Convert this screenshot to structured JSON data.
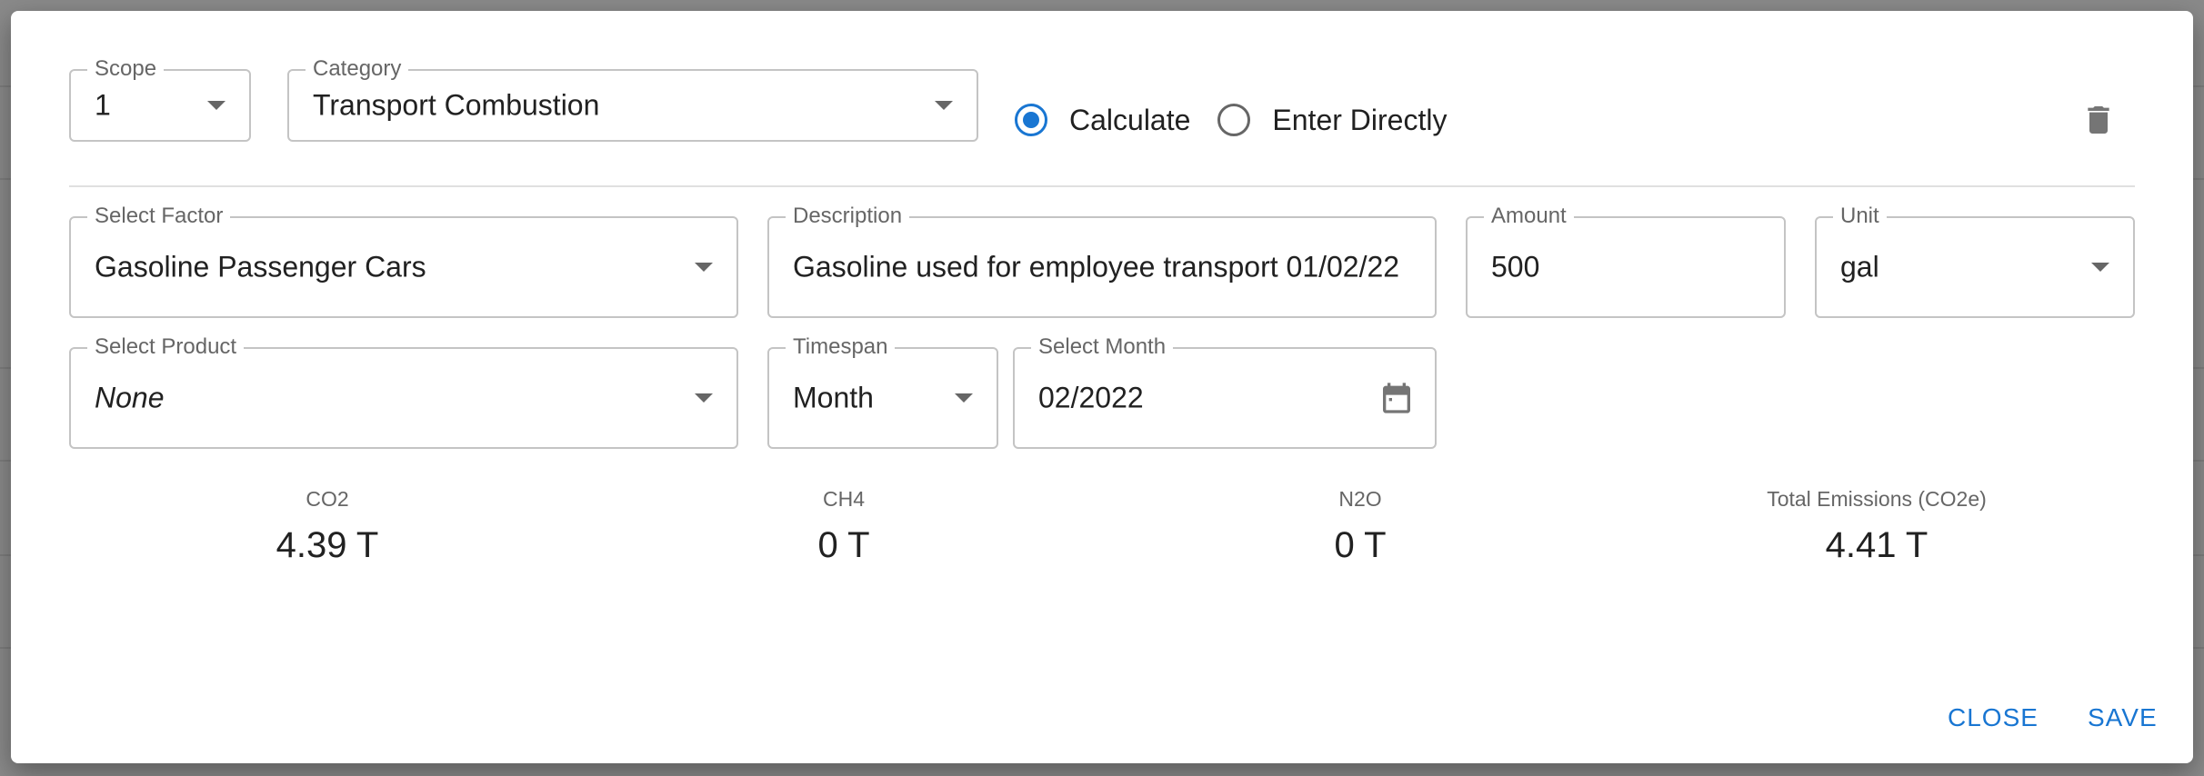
{
  "header": {
    "scope": {
      "label": "Scope",
      "value": "1"
    },
    "category": {
      "label": "Category",
      "value": "Transport Combustion"
    },
    "mode": {
      "options": [
        {
          "label": "Calculate",
          "selected": true
        },
        {
          "label": "Enter Directly",
          "selected": false
        }
      ]
    }
  },
  "form": {
    "factor": {
      "label": "Select Factor",
      "value": "Gasoline Passenger Cars"
    },
    "description": {
      "label": "Description",
      "value": "Gasoline used for employee transport 01/02/22"
    },
    "amount": {
      "label": "Amount",
      "value": "500"
    },
    "unit": {
      "label": "Unit",
      "value": "gal"
    },
    "product": {
      "label": "Select Product",
      "value": "None"
    },
    "timespan": {
      "label": "Timespan",
      "value": "Month"
    },
    "month": {
      "label": "Select Month",
      "value": "02/2022"
    }
  },
  "emissions": [
    {
      "label": "CO2",
      "value": "4.39 T"
    },
    {
      "label": "CH4",
      "value": "0 T"
    },
    {
      "label": "N2O",
      "value": "0 T"
    },
    {
      "label": "Total Emissions (CO2e)",
      "value": "4.41 T"
    }
  ],
  "actions": {
    "close": "CLOSE",
    "save": "SAVE"
  },
  "icons": {
    "delete": "trash-icon",
    "calendar": "calendar-icon",
    "dropdown": "chevron-down-icon"
  },
  "colors": {
    "accent": "#1976d2",
    "border": "#c4c4c4",
    "text": "#212121",
    "muted": "#666666"
  }
}
